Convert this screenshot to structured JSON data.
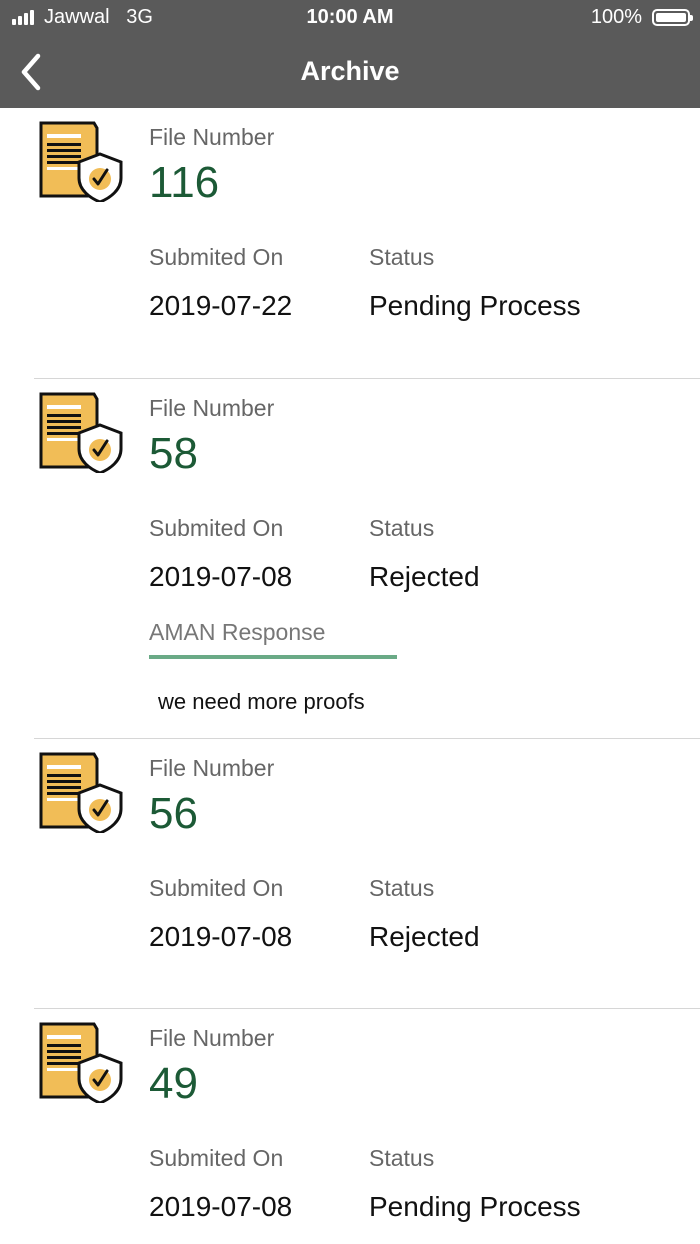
{
  "status_bar": {
    "carrier": "Jawwal",
    "network": "3G",
    "time": "10:00 AM",
    "battery": "100%"
  },
  "nav": {
    "title": "Archive",
    "back_icon": "chevron-left-icon"
  },
  "items": [
    {
      "file_number_label": "File Number",
      "file_number": "116",
      "submitted_label": "Submited On",
      "submitted_on": "2019-07-22",
      "status_label": "Status",
      "status": "Pending Process"
    },
    {
      "file_number_label": "File Number",
      "file_number": "58",
      "submitted_label": "Submited On",
      "submitted_on": "2019-07-08",
      "status_label": "Status",
      "status": "Rejected",
      "response_label": "AMAN Response",
      "response_text": "we need more proofs"
    },
    {
      "file_number_label": "File Number",
      "file_number": "56",
      "submitted_label": "Submited On",
      "submitted_on": "2019-07-08",
      "status_label": "Status",
      "status": "Rejected"
    },
    {
      "file_number_label": "File Number",
      "file_number": "49",
      "submitted_label": "Submited On",
      "submitted_on": "2019-07-08",
      "status_label": "Status",
      "status": "Pending Process"
    }
  ],
  "colors": {
    "header_bg": "#5a5a5a",
    "file_number": "#1c5a36",
    "response_underline": "#6aaa86",
    "icon_fill": "#f1bd57"
  }
}
